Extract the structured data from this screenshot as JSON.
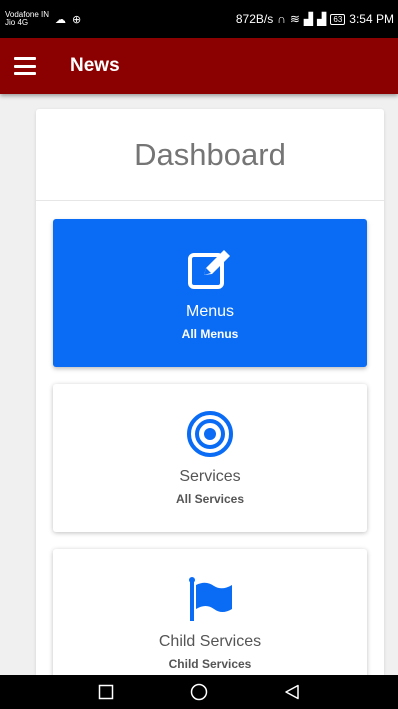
{
  "status_bar": {
    "carrier_1": "Vodafone IN",
    "carrier_2": "Jio 4G",
    "speed": "872B/s",
    "battery": "63",
    "time": "3:54 PM"
  },
  "app_bar": {
    "title": "News"
  },
  "dashboard": {
    "title": "Dashboard",
    "cards": [
      {
        "title": "Menus",
        "subtitle": "All Menus",
        "icon": "edit-icon"
      },
      {
        "title": "Services",
        "subtitle": "All Services",
        "icon": "target-icon"
      },
      {
        "title": "Child Services",
        "subtitle": "Child Services",
        "icon": "flag-icon"
      }
    ]
  },
  "colors": {
    "app_bar": "#8b0000",
    "primary_card": "#0a6cf5",
    "icon_blue": "#0a6cf5",
    "background": "#f0f0f0"
  }
}
